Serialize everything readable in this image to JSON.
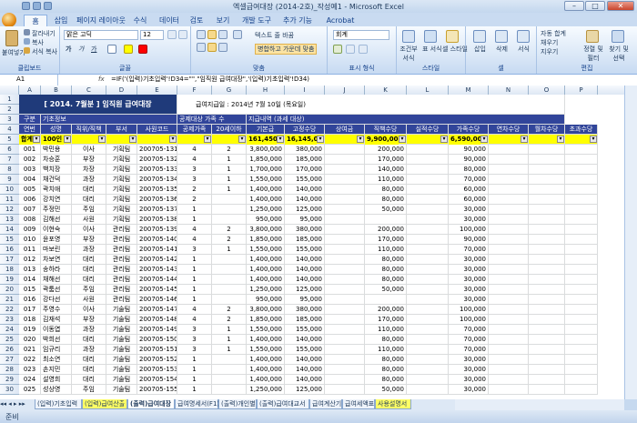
{
  "window": {
    "title": "엑셀급여대장 (2014-2호)_작성예1 - Microsoft Excel",
    "minimize": "–",
    "maximize": "□",
    "close": "✕"
  },
  "tabs": [
    "홈",
    "삽입",
    "페이지 레이아웃",
    "수식",
    "데이터",
    "검토",
    "보기",
    "개발 도구",
    "추가 기능",
    "Acrobat"
  ],
  "ribbon": {
    "clipboard": {
      "paste": "붙여넣기",
      "cut": "잘라내기",
      "copy": "복사",
      "format_painter": "서식 복사",
      "label": "클립보드"
    },
    "font": {
      "name": "맑은 고딕",
      "size": "12",
      "label": "글꼴",
      "bold": "가",
      "italic": "가",
      "underline": "가"
    },
    "align": {
      "wrap": "텍스트 줄 바꿈",
      "merge": "병합하고 가운데 맞춤",
      "label": "맞춤"
    },
    "number": {
      "format": "회계",
      "label": "표시 형식"
    },
    "styles": {
      "cond": "조건부 서식",
      "table": "표 서식",
      "cell": "셀 스타일",
      "label": "스타일"
    },
    "cells": {
      "insert": "삽입",
      "delete": "삭제",
      "format": "서식",
      "label": "셀"
    },
    "editing": {
      "autosum": "자동 합계",
      "fill": "채우기",
      "clear": "지우기",
      "sort": "정렬 및 필터",
      "find": "찾기 및 선택",
      "label": "편집"
    }
  },
  "formula_bar": {
    "name_box": "A1",
    "fx": "fx",
    "formula": "=IF('(입력)기초입력'!D34=\"\",\"임직원 급여대장\",'(입력)기초입력'!D34)"
  },
  "columns": [
    "A",
    "B",
    "C",
    "D",
    "E",
    "F",
    "G",
    "H",
    "I",
    "J",
    "K",
    "L",
    "M",
    "N",
    "O",
    "P"
  ],
  "sheet": {
    "title": "[ 2014. 7월분 ]  임직원 급여대장",
    "pay_date": "급여지급일 : 2014년 7월 10일 (목요일)",
    "group_basic": "기초정보",
    "group_family": "공제대상 가족 수",
    "group_pay": "지급내역 (과세 대상)",
    "header_gubun": "구분",
    "headers": [
      "연번",
      "성명",
      "직위/직책",
      "부서",
      "사원코드",
      "공제가족",
      "20세이하",
      "기본급",
      "고정수당",
      "상여금",
      "직책수당",
      "실적수당",
      "가족수당",
      "연차수당",
      "월차수당",
      "초과수당"
    ],
    "totals": {
      "label": "합계",
      "count": "100인",
      "base": "161,450,00",
      "fixed": "16,145,00",
      "position": "9,900,00",
      "family": "6,590,00"
    },
    "rows": [
      [
        "001",
        "박민용",
        "이사",
        "기획팀",
        "200705-131",
        "4",
        "2",
        "3,800,000",
        "380,000",
        "",
        "200,000",
        "",
        "90,000"
      ],
      [
        "002",
        "차승훈",
        "부장",
        "기획팀",
        "200705-132",
        "4",
        "1",
        "1,850,000",
        "185,000",
        "",
        "170,000",
        "",
        "90,000"
      ],
      [
        "003",
        "백치장",
        "차장",
        "기획팀",
        "200705-133",
        "3",
        "1",
        "1,700,000",
        "170,000",
        "",
        "140,000",
        "",
        "80,000"
      ],
      [
        "004",
        "채건덕",
        "과장",
        "기획팀",
        "200705-134",
        "3",
        "1",
        "1,550,000",
        "155,000",
        "",
        "110,000",
        "",
        "70,000"
      ],
      [
        "005",
        "곽치애",
        "대리",
        "기획팀",
        "200705-135",
        "2",
        "1",
        "1,400,000",
        "140,000",
        "",
        "80,000",
        "",
        "60,000"
      ],
      [
        "006",
        "강치연",
        "대리",
        "기획팀",
        "200705-136",
        "2",
        "",
        "1,400,000",
        "140,000",
        "",
        "80,000",
        "",
        "60,000"
      ],
      [
        "007",
        "주정민",
        "주임",
        "기획팀",
        "200705-137",
        "1",
        "",
        "1,250,000",
        "125,000",
        "",
        "50,000",
        "",
        "30,000"
      ],
      [
        "008",
        "김해선",
        "사원",
        "기획팀",
        "200705-138",
        "1",
        "",
        "950,000",
        "95,000",
        "",
        "",
        "",
        "30,000"
      ],
      [
        "009",
        "이현숙",
        "이사",
        "관리팀",
        "200705-139",
        "4",
        "2",
        "3,800,000",
        "380,000",
        "",
        "200,000",
        "",
        "100,000"
      ],
      [
        "010",
        "윤포영",
        "부장",
        "관리팀",
        "200705-140",
        "4",
        "2",
        "1,850,000",
        "185,000",
        "",
        "170,000",
        "",
        "90,000"
      ],
      [
        "011",
        "마보린",
        "과장",
        "관리팀",
        "200705-141",
        "3",
        "1",
        "1,550,000",
        "155,000",
        "",
        "110,000",
        "",
        "70,000"
      ],
      [
        "012",
        "차보연",
        "대리",
        "관리팀",
        "200705-142",
        "1",
        "",
        "1,400,000",
        "140,000",
        "",
        "80,000",
        "",
        "30,000"
      ],
      [
        "013",
        "송하라",
        "대리",
        "관리팀",
        "200705-143",
        "1",
        "",
        "1,400,000",
        "140,000",
        "",
        "80,000",
        "",
        "30,000"
      ],
      [
        "014",
        "채해선",
        "대리",
        "관리팀",
        "200705-144",
        "1",
        "",
        "1,400,000",
        "140,000",
        "",
        "80,000",
        "",
        "30,000"
      ],
      [
        "015",
        "곽툼선",
        "주임",
        "관리팀",
        "200705-145",
        "1",
        "",
        "1,250,000",
        "125,000",
        "",
        "50,000",
        "",
        "30,000"
      ],
      [
        "016",
        "강다선",
        "사원",
        "관리팀",
        "200705-146",
        "1",
        "",
        "950,000",
        "95,000",
        "",
        "",
        "",
        "30,000"
      ],
      [
        "017",
        "주영수",
        "이사",
        "기술팀",
        "200705-147",
        "4",
        "2",
        "3,800,000",
        "380,000",
        "",
        "200,000",
        "",
        "100,000"
      ],
      [
        "018",
        "김재석",
        "부장",
        "기술팀",
        "200705-148",
        "4",
        "2",
        "1,850,000",
        "185,000",
        "",
        "170,000",
        "",
        "100,000"
      ],
      [
        "019",
        "이동엽",
        "과장",
        "기술팀",
        "200705-149",
        "3",
        "1",
        "1,550,000",
        "155,000",
        "",
        "110,000",
        "",
        "70,000"
      ],
      [
        "020",
        "박희선",
        "대리",
        "기술팀",
        "200705-150",
        "3",
        "1",
        "1,400,000",
        "140,000",
        "",
        "80,000",
        "",
        "70,000"
      ],
      [
        "021",
        "임규리",
        "과장",
        "기술팀",
        "200705-151",
        "3",
        "1",
        "1,550,000",
        "155,000",
        "",
        "110,000",
        "",
        "70,000"
      ],
      [
        "022",
        "최소연",
        "대리",
        "기술팀",
        "200705-152",
        "1",
        "",
        "1,400,000",
        "140,000",
        "",
        "80,000",
        "",
        "30,000"
      ],
      [
        "023",
        "손지민",
        "대리",
        "기술팀",
        "200705-153",
        "1",
        "",
        "1,400,000",
        "140,000",
        "",
        "80,000",
        "",
        "30,000"
      ],
      [
        "024",
        "설영희",
        "대리",
        "기술팀",
        "200705-154",
        "1",
        "",
        "1,400,000",
        "140,000",
        "",
        "80,000",
        "",
        "30,000"
      ],
      [
        "025",
        "성상영",
        "주임",
        "기술팀",
        "200705-155",
        "1",
        "",
        "1,250,000",
        "125,000",
        "",
        "50,000",
        "",
        "30,000"
      ]
    ]
  },
  "sheet_tabs": [
    "(입력)기초입력",
    "(입력)급여산출",
    "(출력)급여대장",
    "급여명세서(F1)",
    "(출력)개인별",
    "(출력)급여대교서",
    "급여계산기",
    "급여세액표",
    "사용설명서"
  ],
  "status": "준비"
}
